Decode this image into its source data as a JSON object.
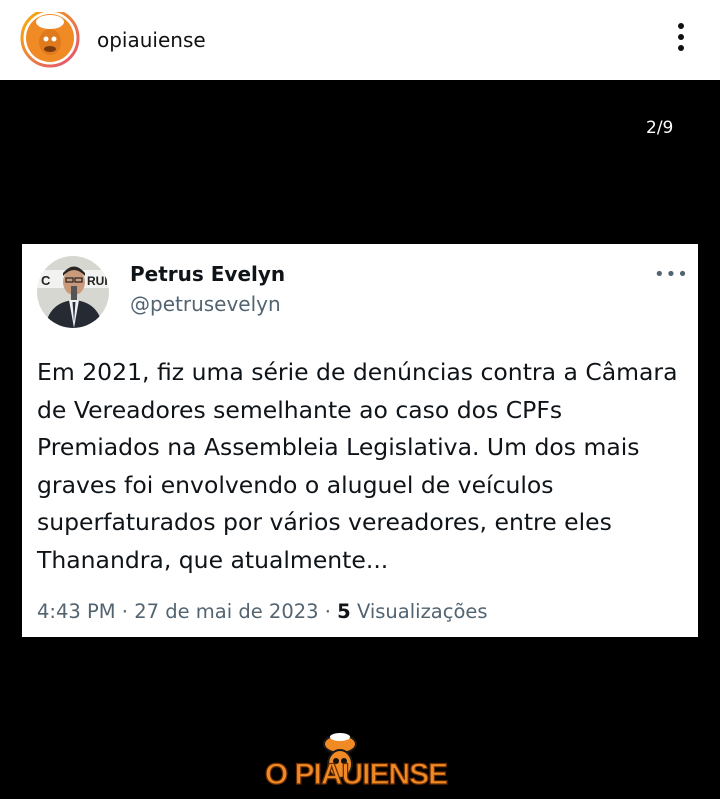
{
  "header": {
    "username": "opiauiense",
    "avatar_icon": "mascot-avatar-icon",
    "more_icon": "vertical-dots-icon"
  },
  "post": {
    "counter": "2/9",
    "tweet": {
      "display_name": "Petrus Evelyn",
      "handle": "@petrusevelyn",
      "more_label": "•••",
      "text": "Em 2021, fiz uma série de denúncias contra a Câmara de Vereadores semelhante ao caso dos CPFs Premiados na Assembleia Legislativa. Um dos mais graves foi envolvendo o aluguel de veículos superfaturados por vários vereadores, entre eles Thanandra, que atualmente...",
      "time": "4:43 PM",
      "date": "27 de mai de 2023",
      "separator": "·",
      "views_count": "5",
      "views_label": "Visualizações"
    },
    "brand_logo_text": "O PIAUIENSE"
  },
  "colors": {
    "accent": "#f08a24",
    "ring": "#e44d7a",
    "text": "#0f1419",
    "muted": "#536471"
  }
}
